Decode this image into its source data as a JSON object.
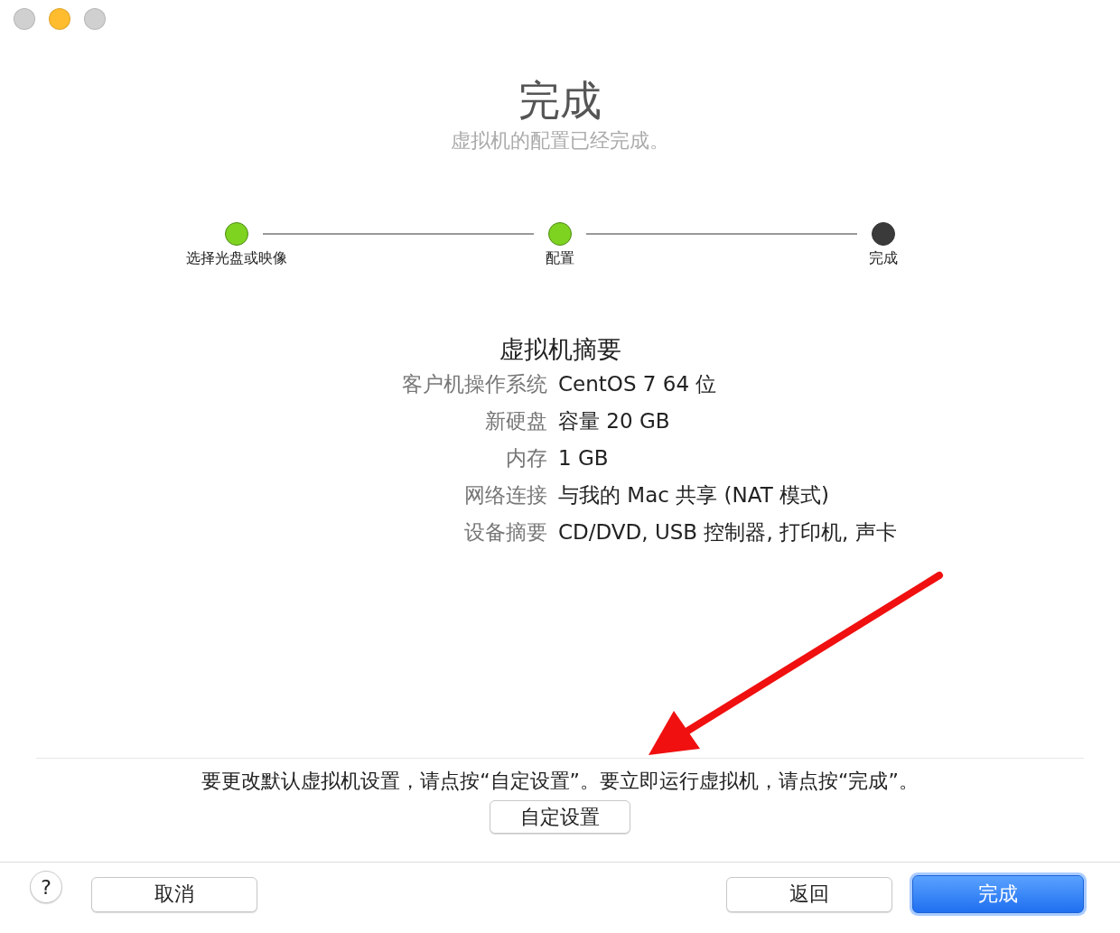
{
  "window": {
    "controls": [
      {
        "kind": "close",
        "active": false
      },
      {
        "kind": "minimize",
        "active": true
      },
      {
        "kind": "zoom",
        "active": false
      }
    ]
  },
  "header": {
    "title": "完成",
    "subtitle": "虚拟机的配置已经完成。"
  },
  "steps": [
    {
      "label": "选择光盘或映像",
      "completed": true
    },
    {
      "label": "配置",
      "completed": true
    },
    {
      "label": "完成",
      "completed": false
    }
  ],
  "summary": {
    "heading": "虚拟机摘要",
    "rows": [
      {
        "label": "客户机操作系统",
        "value": "CentOS 7 64 位"
      },
      {
        "label": "新硬盘",
        "value": "容量 20 GB"
      },
      {
        "label": "内存",
        "value": "1 GB"
      },
      {
        "label": "网络连接",
        "value": "与我的 Mac 共享 (NAT 模式)"
      },
      {
        "label": "设备摘要",
        "value": "CD/DVD, USB 控制器, 打印机, 声卡"
      }
    ]
  },
  "note": "要更改默认虚拟机设置，请点按“自定设置”。要立即运行虚拟机，请点按“完成”。",
  "customize_button": "自定设置",
  "footer": {
    "help": "?",
    "cancel": "取消",
    "back": "返回",
    "finish": "完成"
  }
}
